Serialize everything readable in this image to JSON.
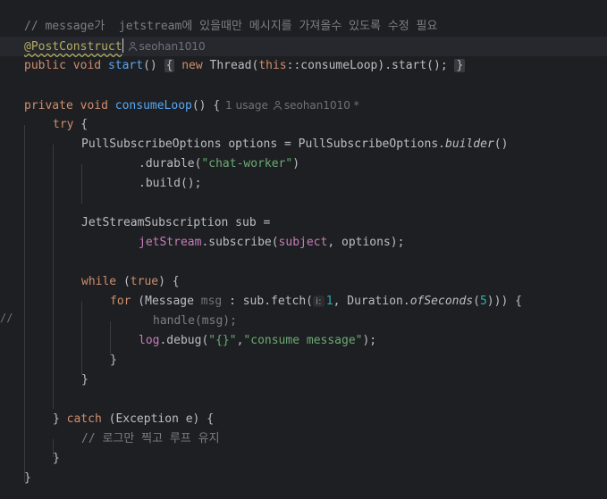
{
  "editor": {
    "comment_top": "// message가  jetstream에 있을때만 메시지를 가져올수 있도록 수정 필요",
    "annotation": "@PostConstruct",
    "author_hint_1": "seohan1010",
    "line_start": {
      "public": "public",
      "void": "void",
      "name": "start",
      "paren": "()",
      "fold_open": "{",
      "new_kw": "new",
      "body_mid": " Thread(",
      "this_kw": "this",
      "body_end": "::consumeLoop).start();",
      "fold_close": "}"
    },
    "line_consume": {
      "private": "private",
      "void": "void",
      "name": "consumeLoop",
      "rest": "() {",
      "usage_hint": "1 usage",
      "author_hint": "seohan1010 *"
    },
    "try_kw": "try",
    "try_brace": " {",
    "opts_line": "PullSubscribeOptions options = PullSubscribeOptions.",
    "opts_builder": "builder",
    "opts_paren": "()",
    "durable_a": ".durable(",
    "durable_str": "\"chat-worker\"",
    "durable_b": ")",
    "build_line": ".build();",
    "sub_line": "JetStreamSubscription sub =",
    "js_field": "jetStream",
    "subscribe_a": ".subscribe(",
    "subject_field": "subject",
    "subscribe_b": ", options);",
    "while_kw": "while",
    "while_a": " (",
    "true_kw": "true",
    "while_b": ") {",
    "for_kw": "for",
    "for_a": " (Message ",
    "msg_var": "msg",
    "for_b": " : sub.fetch(",
    "param_hint": "i:",
    "num_1": "1",
    "for_c": ", Duration.",
    "of_seconds": "ofSeconds",
    "for_d": "(",
    "num_5": "5",
    "for_e": "))) {",
    "handle_line": "handle(msg);",
    "log_field": "log",
    "log_a": ".debug(",
    "log_str1": "\"{}\"",
    "log_comma": ",",
    "log_str2": "\"consume message\"",
    "log_b": ");",
    "close_for": "}",
    "close_while": "}",
    "catch_open": "} ",
    "catch_kw": "catch",
    "catch_rest": " (Exception e) {",
    "catch_comment": "// 로그만 찍고 루프 유지",
    "close_catch": "}",
    "close_method": "}",
    "gutter_mark": "//"
  }
}
